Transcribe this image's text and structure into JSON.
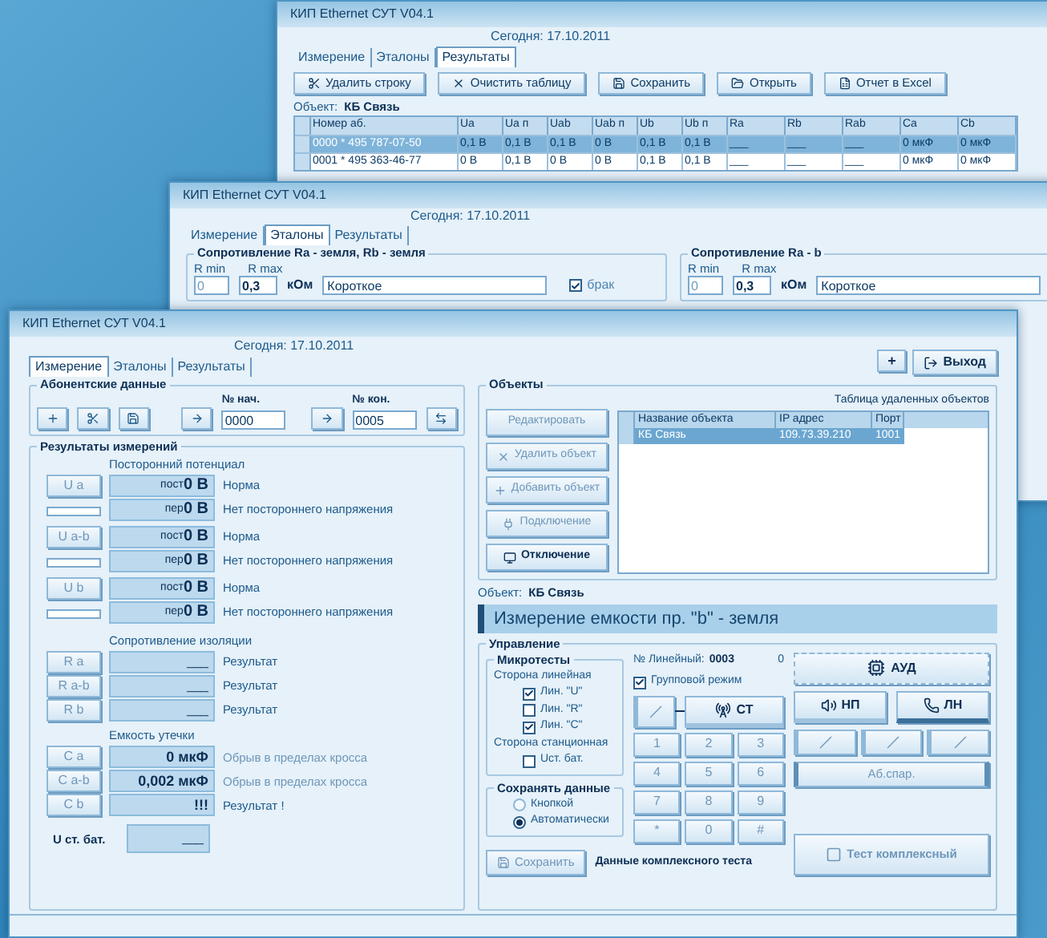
{
  "results_window": {
    "title": "КИП Ethernet СУТ V04.1",
    "date": "Сегодня: 17.10.2011",
    "tabs": [
      {
        "label": "Измерение",
        "selected": false
      },
      {
        "label": "Эталоны",
        "selected": false
      },
      {
        "label": "Результаты",
        "selected": true
      }
    ],
    "toolbar": [
      "Удалить строку",
      "Очистить таблицу",
      "Сохранить",
      "Открыть",
      "Отчет в Excel"
    ],
    "object_label": "Объект:",
    "object_name": "КБ Связь",
    "table": {
      "columns": [
        "Номер аб.",
        "Ua",
        "Ua п",
        "Uab",
        "Uab п",
        "Ub",
        "Ub п",
        "Ra",
        "Rb",
        "Rab",
        "Ca",
        "Cb"
      ],
      "rows": [
        {
          "selected": true,
          "cells": [
            "0000 * 495 787-07-50",
            "0,1 В",
            "0,1 В",
            "0,1 В",
            "0 В",
            "0,1 В",
            "0,1 В",
            "___",
            "___",
            "___",
            "0 мкФ",
            "0 мкФ"
          ]
        },
        {
          "selected": false,
          "cells": [
            "0001 * 495 363-46-77",
            "0 В",
            "0,1 В",
            "0 В",
            "0 В",
            "0,1 В",
            "0,1 В",
            "___",
            "___",
            "___",
            "0 мкФ",
            "0 мкФ"
          ]
        }
      ]
    }
  },
  "standards_window": {
    "title": "КИП Ethernet СУТ V04.1",
    "date": "Сегодня: 17.10.2011",
    "tabs": [
      {
        "label": "Измерение",
        "selected": false
      },
      {
        "label": "Эталоны",
        "selected": true
      },
      {
        "label": "Результаты",
        "selected": false
      }
    ],
    "groups": [
      {
        "title": "Сопротивление Ra - земля, Rb - земля",
        "rmin_label": "R min",
        "rmax_label": "R max",
        "rmin": "0",
        "rmax": "0,3",
        "unit": "кОм",
        "result": "Короткое",
        "reject": {
          "label": "брак",
          "checked": true
        }
      },
      {
        "title": "Сопротивление Ra - b",
        "rmin_label": "R min",
        "rmax_label": "R max",
        "rmin": "0",
        "rmax": "0,3",
        "unit": "кОм",
        "result": "Короткое"
      }
    ]
  },
  "measure_window": {
    "title": "КИП Ethernet СУТ V04.1",
    "date": "Сегодня: 17.10.2011",
    "tabs": [
      {
        "label": "Измерение",
        "selected": true
      },
      {
        "label": "Эталоны",
        "selected": false
      },
      {
        "label": "Результаты",
        "selected": false
      }
    ],
    "add_button": "+",
    "exit_button": "Выход",
    "subscriber": {
      "title": "Абонентские данные",
      "start_label": "№ нач.",
      "start": "0000",
      "end_label": "№ кон.",
      "end": "0005"
    },
    "results": {
      "title": "Результаты измерений",
      "potential": {
        "title": "Посторонний потенциал",
        "rows": [
          {
            "button": "U a",
            "dc_label": "пост",
            "dc": "0 В",
            "ac_label": "пер",
            "ac": "0 В",
            "dc_status": "Норма",
            "ac_status": "Нет постороннего напряжения"
          },
          {
            "button": "U a-b",
            "dc_label": "пост",
            "dc": "0 В",
            "ac_label": "пер",
            "ac": "0 В",
            "dc_status": "Норма",
            "ac_status": "Нет постороннего напряжения"
          },
          {
            "button": "U b",
            "dc_label": "пост",
            "dc": "0 В",
            "ac_label": "пер",
            "ac": "0 В",
            "dc_status": "Норма",
            "ac_status": "Нет постороннего напряжения"
          }
        ]
      },
      "insulation": {
        "title": "Сопротивление изоляции",
        "rows": [
          {
            "button": "R a",
            "value": "___",
            "status": "Результат",
            "faded": false
          },
          {
            "button": "R a-b",
            "value": "___",
            "status": "Результат",
            "faded": false
          },
          {
            "button": "R b",
            "value": "___",
            "status": "Результат",
            "faded": false
          }
        ]
      },
      "capacitance": {
        "title": "Емкость утечки",
        "rows": [
          {
            "button": "C a",
            "value": "0 мкФ",
            "status": "Обрыв в пределах кросса",
            "faded": true
          },
          {
            "button": "C a-b",
            "value": "0,002 мкФ",
            "status": "Обрыв в пределах кросса",
            "faded": true
          },
          {
            "button": "C b",
            "value": "!!!",
            "status": "Результат !",
            "faded": false
          }
        ]
      },
      "battery": {
        "label": "U ст. бат.",
        "value": "___"
      }
    },
    "objects": {
      "title": "Объекты",
      "table_title": "Таблица удаленных объектов",
      "buttons": [
        {
          "label": "Редактировать",
          "disabled": true
        },
        {
          "label": "Удалить объект",
          "disabled": true
        },
        {
          "label": "Добавить объект",
          "disabled": true
        },
        {
          "label": "Подключение",
          "disabled": true
        },
        {
          "label": "Отключение",
          "disabled": false
        }
      ],
      "columns": [
        "Название объекта",
        "IP адрес",
        "Порт"
      ],
      "rows": [
        {
          "selected": true,
          "cells": [
            "КБ Связь",
            "109.73.39.210",
            "1001"
          ]
        }
      ]
    },
    "object_label": "Объект:",
    "object_name": "КБ Связь",
    "banner": "Измерение емкости пр. \"b\" - земля",
    "control": {
      "title": "Управление",
      "microtests": {
        "title": "Микротесты",
        "items": [
          {
            "kind": "heading",
            "label": "Сторона линейная"
          },
          {
            "kind": "checkbox",
            "label": "Лин. \"U\"",
            "checked": true
          },
          {
            "kind": "checkbox",
            "label": "Лин. \"R\"",
            "checked": false
          },
          {
            "kind": "checkbox",
            "label": "Лин. \"C\"",
            "checked": true
          },
          {
            "kind": "heading",
            "label": "Сторона станционная"
          },
          {
            "kind": "checkbox",
            "label": "Uст. бат.",
            "checked": false
          }
        ]
      },
      "save_mode": {
        "title": "Сохранять данные",
        "options": [
          {
            "label": "Кнопкой",
            "selected": false
          },
          {
            "label": "Автоматически",
            "selected": true
          }
        ]
      },
      "save_button": {
        "label": "Сохранить",
        "disabled": true
      },
      "complex_label": "Данные комплексного теста",
      "line_label": "№ Линейный:",
      "line_number": "0003",
      "line_extra": "0",
      "group_mode": {
        "label": "Групповой режим",
        "checked": true
      },
      "st_button": "СТ",
      "np_button": "НП",
      "ln_button": "ЛН",
      "aud_button": "АУД",
      "keypad": [
        "1",
        "2",
        "3",
        "4",
        "5",
        "6",
        "7",
        "8",
        "9",
        "*",
        "0",
        "#"
      ],
      "pair_button": "Аб.спар.",
      "complex_test": {
        "label": "Тест комплексный",
        "disabled": true
      }
    }
  }
}
